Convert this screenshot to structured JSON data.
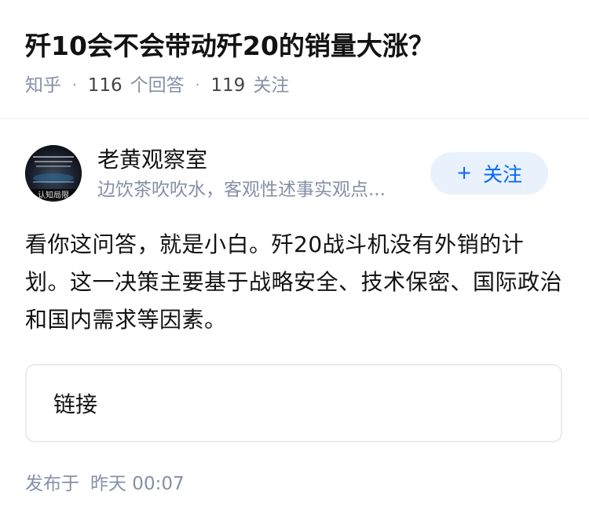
{
  "question": {
    "title": "歼10会不会带动歼20的销量大涨？",
    "source": "知乎",
    "separator": "·",
    "answer_count": "116",
    "answer_label": "个回答",
    "follower_count": "119",
    "follower_label": "关注"
  },
  "author": {
    "name": "老黄观察室",
    "bio": "边饮茶吹吹水，客观性述事实观点...",
    "avatar_caption": "认知局限",
    "follow_label": "关注",
    "follow_plus": "+"
  },
  "answer": {
    "text": "看你这问答，就是小白。歼20战斗机没有外销的计划。这一决策主要基于战略安全、技术保密、国际政治和国内需求等因素。"
  },
  "link_card": {
    "label": "链接"
  },
  "footer": {
    "published_label": "发布于",
    "published_time": "昨天 00:07"
  },
  "colors": {
    "accent": "#0066ff",
    "follow_bg": "#e8f1fc",
    "muted": "#8590a6"
  }
}
